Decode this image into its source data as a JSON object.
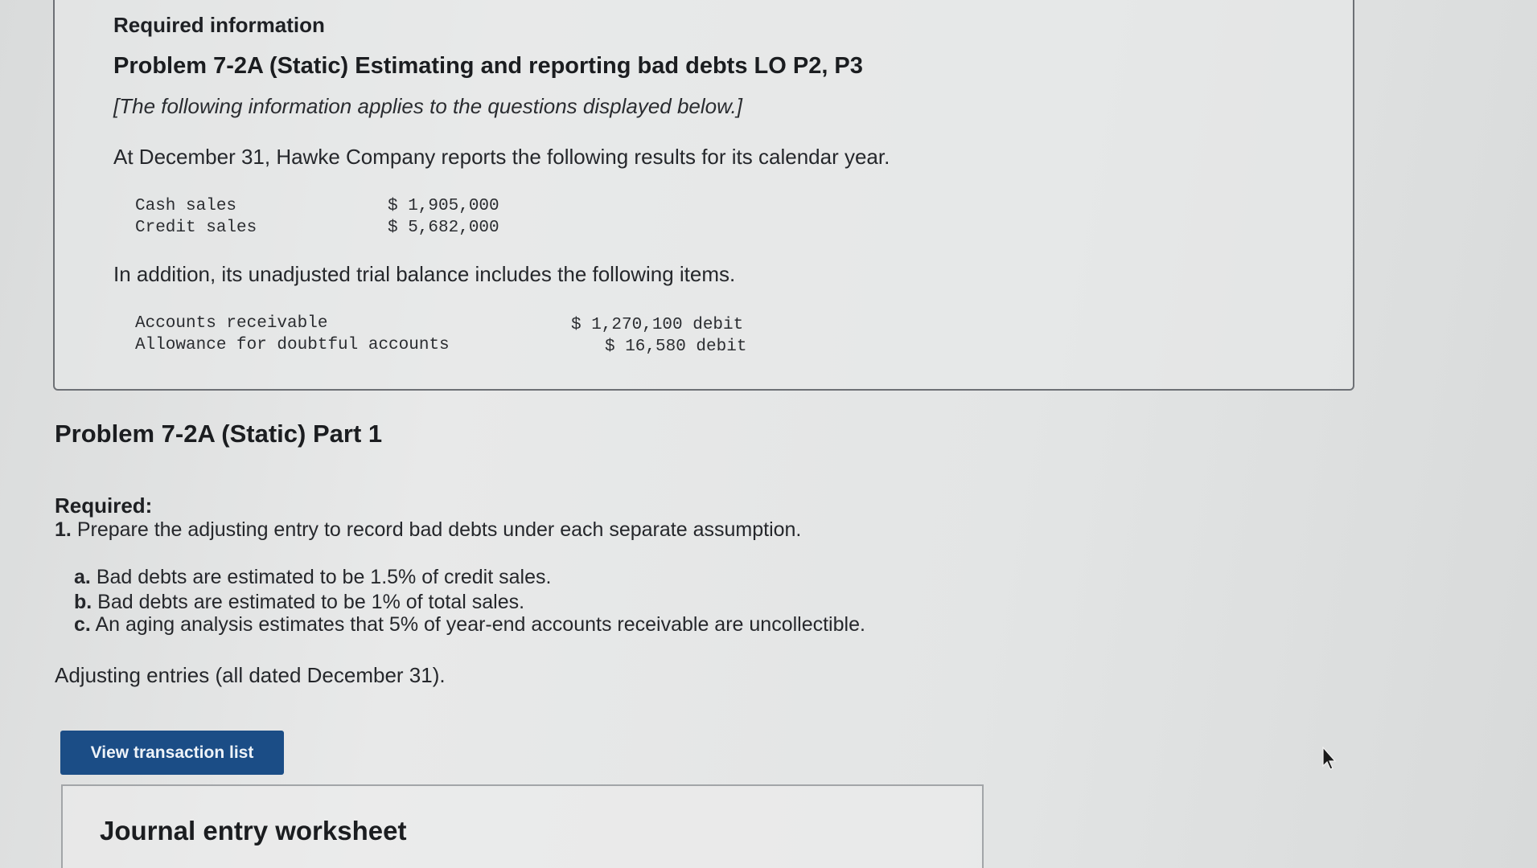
{
  "info": {
    "heading": "Required information",
    "problem_title": "Problem 7-2A (Static) Estimating and reporting bad debts LO P2, P3",
    "note": "[The following information applies to the questions displayed below.]",
    "intro": "At December 31, Hawke Company reports the following results for its calendar year.",
    "sales": [
      {
        "label": "Cash sales",
        "value": "$ 1,905,000"
      },
      {
        "label": "Credit sales",
        "value": "$ 5,682,000"
      }
    ],
    "trial_intro": "In addition, its unadjusted trial balance includes the following items.",
    "trial_items": [
      {
        "label": "Accounts receivable",
        "value": "$ 1,270,100 debit"
      },
      {
        "label": "Allowance for doubtful accounts",
        "value": "$ 16,580 debit"
      }
    ]
  },
  "part": {
    "title": "Problem 7-2A (Static) Part 1",
    "required_label": "Required:",
    "req_number": "1.",
    "req_text": "Prepare the adjusting entry to record bad debts under each separate assumption.",
    "assumptions": [
      {
        "letter": "a.",
        "text": "Bad debts are estimated to be 1.5% of credit sales."
      },
      {
        "letter": "b.",
        "text": "Bad debts are estimated to be 1% of total sales."
      },
      {
        "letter": "c.",
        "text": "An aging analysis estimates that 5% of year-end accounts receivable are uncollectible."
      }
    ],
    "entries_caption": "Adjusting entries (all dated December 31)."
  },
  "actions": {
    "view_transactions": "View transaction list"
  },
  "worksheet": {
    "title": "Journal entry worksheet"
  },
  "icons": {
    "cursor": "mouse-pointer-icon"
  }
}
